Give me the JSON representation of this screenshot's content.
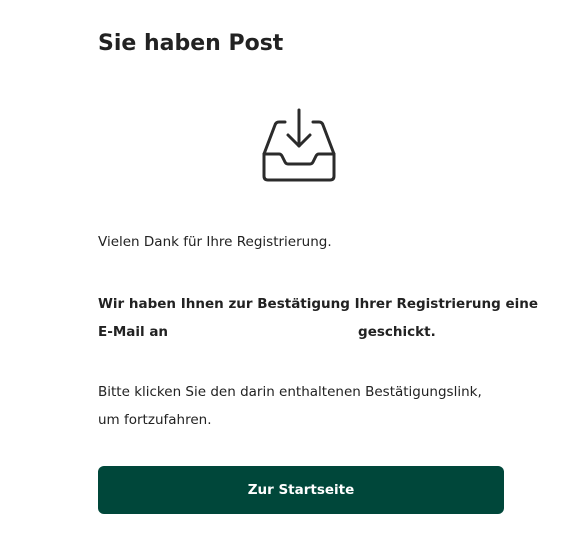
{
  "page": {
    "title": "Sie haben Post"
  },
  "icon": "inbox-download-icon",
  "message": {
    "thanks": "Vielen Dank für Ihre Registrierung.",
    "confirm_line1": "Wir haben Ihnen zur Bestätigung Ihrer Registrierung eine",
    "confirm_line2_prefix": "E-Mail an",
    "confirm_line2_suffix": "geschickt.",
    "instruction_line1": "Bitte klicken Sie den darin enthaltenen Bestätigungslink,",
    "instruction_line2": "um fortzufahren."
  },
  "actions": {
    "home_label": "Zur Startseite"
  },
  "colors": {
    "accent": "#00473a",
    "text": "#222222"
  }
}
